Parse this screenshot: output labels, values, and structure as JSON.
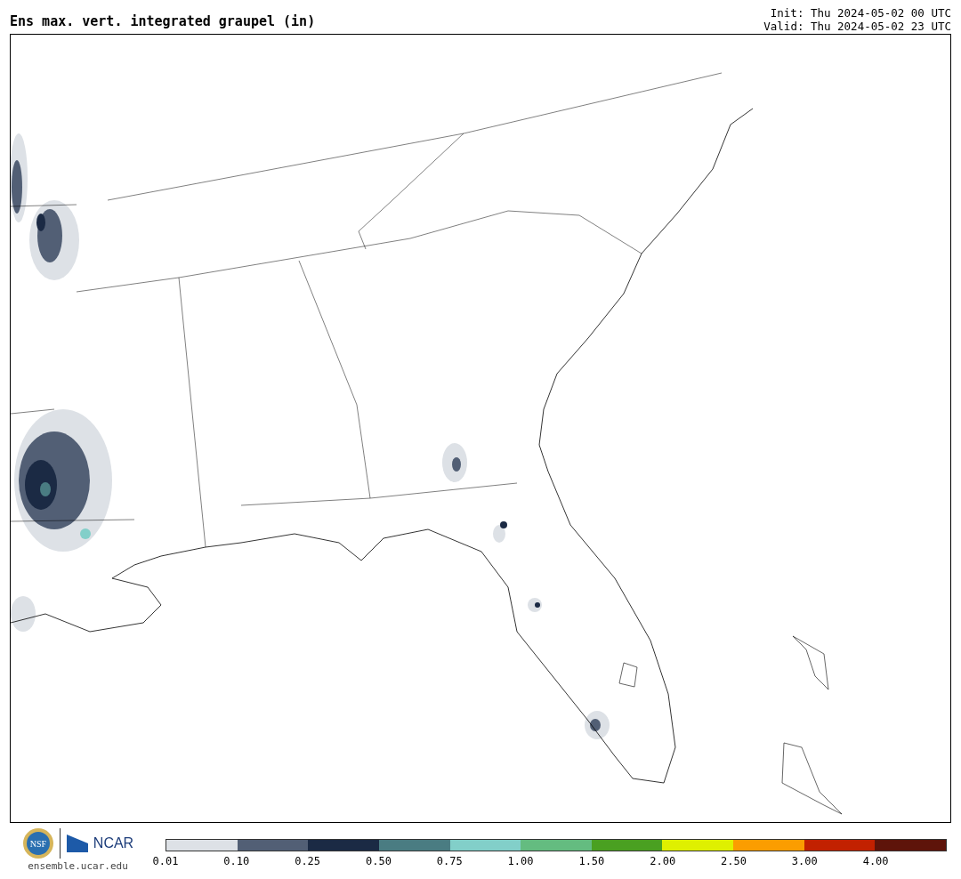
{
  "title": "Ens max. vert. integrated graupel (in)",
  "init": "Init: Thu 2024-05-02 00 UTC",
  "valid": "Valid: Thu 2024-05-02 23 UTC",
  "logos": {
    "nsf": "NSF",
    "ncar": "NCAR",
    "url": "ensemble.ucar.edu"
  },
  "colorbar": [
    {
      "label": "0.01",
      "color": "#dde1e6"
    },
    {
      "label": "0.10",
      "color": "#525f75"
    },
    {
      "label": "0.25",
      "color": "#1b2a44"
    },
    {
      "label": "0.50",
      "color": "#4a7c82"
    },
    {
      "label": "0.75",
      "color": "#82cfc9"
    },
    {
      "label": "1.00",
      "color": "#64bc80"
    },
    {
      "label": "1.50",
      "color": "#4aa021"
    },
    {
      "label": "2.00",
      "color": "#dff000"
    },
    {
      "label": "2.50",
      "color": "#fb9d00"
    },
    {
      "label": "3.00",
      "color": "#c22100"
    },
    {
      "label": "4.00",
      "color": "#5e140a"
    }
  ]
}
